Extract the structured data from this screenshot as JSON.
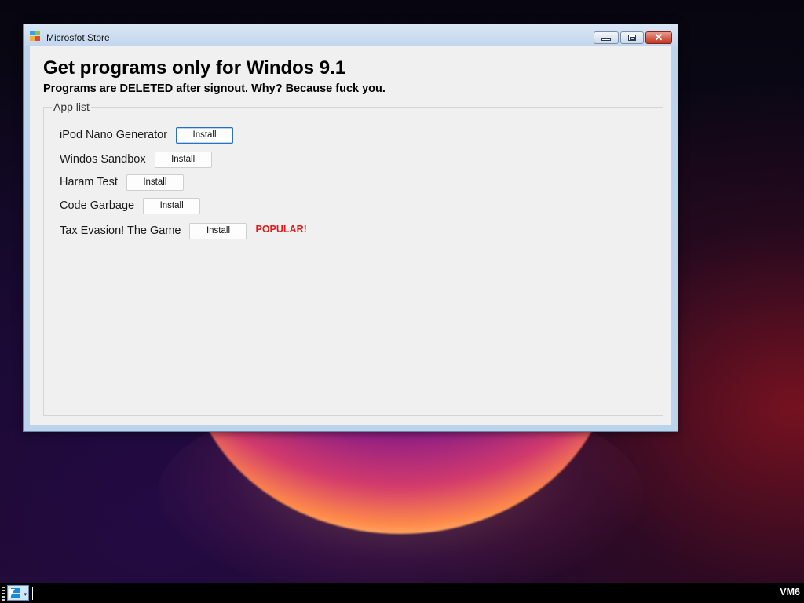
{
  "window": {
    "title": "Microsfot Store",
    "close_symbol": "✕",
    "heading": "Get programs only for Windos 9.1",
    "subheading": "Programs are DELETED after signout. Why? Because fuck you.",
    "group_label": "App list"
  },
  "apps": [
    {
      "name": "iPod Nano Generator",
      "button": "Install"
    },
    {
      "name": "Windos Sandbox",
      "button": "Install"
    },
    {
      "name": "Haram Test",
      "button": "Install"
    },
    {
      "name": "Code Garbage",
      "button": "Install"
    },
    {
      "name": "Tax Evasion! The Game",
      "button": "Install",
      "badge": "POPULAR!"
    }
  ],
  "taskbar": {
    "vm_label": "VM6",
    "start_arrow": "▾"
  },
  "colors": {
    "popular_badge": "#e01b1b",
    "focus_border": "#2a6fc0",
    "close_button": "#c3331e"
  },
  "icons": [
    "store-app-icon",
    "minimize-icon",
    "maximize-icon",
    "close-icon",
    "windows-logo-icon",
    "mouse-pointer-icon"
  ]
}
